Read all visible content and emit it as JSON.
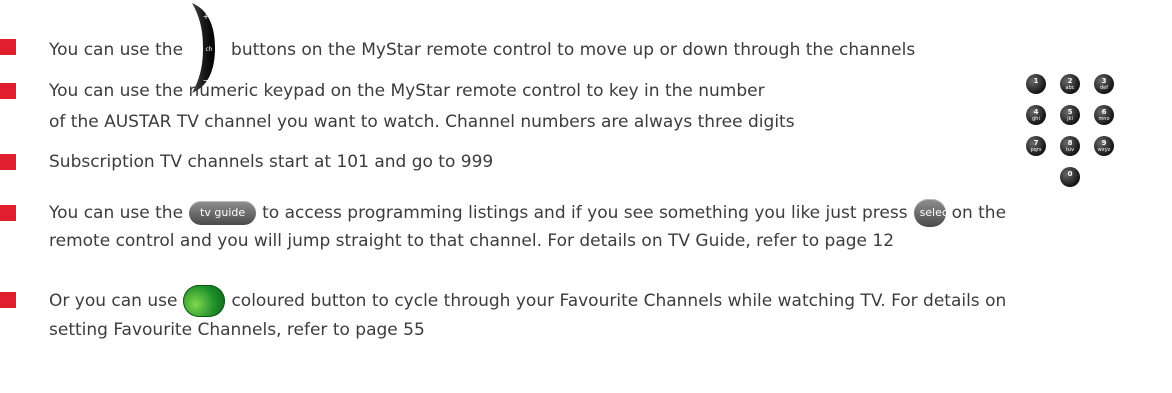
{
  "colors": {
    "bullet": "#e01e2e",
    "text": "#3c3c3c",
    "green_button": "#1e8f2a",
    "button_grey": "#6b6b6b"
  },
  "bullets": [
    {
      "text_before": "You can use the",
      "icon": "ch-rocker-icon",
      "text_after": "buttons on the MyStar remote control to move up or down through the channels"
    },
    {
      "line1": "You can use the numeric keypad on the MyStar remote control to key in the number",
      "line2": "of the AUSTAR TV channel you want to watch. Channel numbers are always three digits"
    },
    {
      "text": "Subscription TV channels start at 101 and go to 999"
    },
    {
      "text_before": "You can use the",
      "button1": "tv guide",
      "text_middle": "to access programming listings and if you see something you like just press",
      "button2": "select",
      "text_after": "on the",
      "line2": "remote control and you will jump straight to that channel. For details on TV Guide, refer to page 12"
    },
    {
      "text_before": "Or you can use",
      "icon": "green-button-icon",
      "text_after": "coloured button to cycle through your Favourite Channels while watching TV. For details on",
      "line2": "setting Favourite Channels, refer to page 55"
    }
  ],
  "rocker": {
    "plus": "+",
    "ch": "ch",
    "minus": "−"
  },
  "keypad": [
    {
      "num": "1",
      "letters": ""
    },
    {
      "num": "2",
      "letters": "abc"
    },
    {
      "num": "3",
      "letters": "def"
    },
    {
      "num": "4",
      "letters": "ghi"
    },
    {
      "num": "5",
      "letters": "jkl"
    },
    {
      "num": "6",
      "letters": "mno"
    },
    {
      "num": "7",
      "letters": "pqrs"
    },
    {
      "num": "8",
      "letters": "tuv"
    },
    {
      "num": "9",
      "letters": "wxyz"
    },
    {
      "num": "0",
      "letters": ""
    }
  ]
}
